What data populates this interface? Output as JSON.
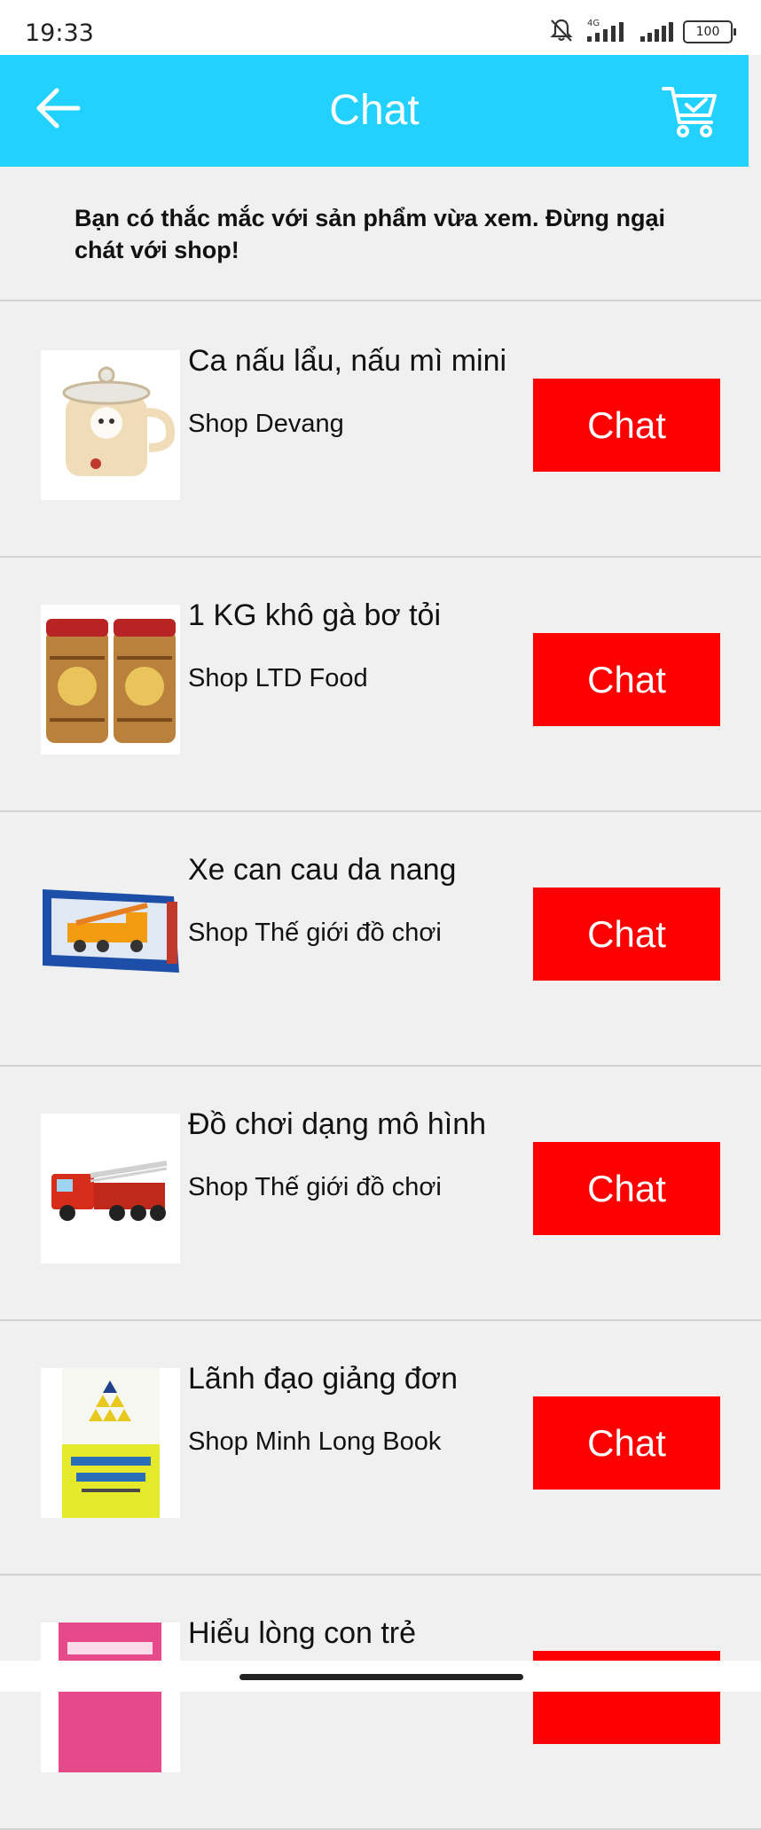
{
  "status_bar": {
    "time": "19:33",
    "battery": "100",
    "network": "4G"
  },
  "app_bar": {
    "title": "Chat",
    "back_icon": "arrow-left-icon",
    "cart_icon": "shopping-cart-check-icon",
    "background": "#22d1fd"
  },
  "intro": {
    "text": "Bạn có thắc mắc với sản phẩm vừa xem. Đừng ngại chát với shop!"
  },
  "items": [
    {
      "product": "Ca nấu lẩu, nấu mì mini",
      "shop": "Shop Devang",
      "button": "Chat",
      "image": "electric-pot-image"
    },
    {
      "product": "1 KG khô gà bơ tỏi",
      "shop": "Shop LTD Food",
      "button": "Chat",
      "image": "chicken-jars-image"
    },
    {
      "product": "Xe can cau da nang",
      "shop": "Shop Thế giới đồ chơi",
      "button": "Chat",
      "image": "crane-truck-box-image"
    },
    {
      "product": "Đồ chơi dạng mô hình",
      "shop": "Shop Thế giới đồ chơi",
      "button": "Chat",
      "image": "fire-truck-image"
    },
    {
      "product": "Lãnh đạo giảng đơn",
      "shop": "Shop Minh Long Book",
      "button": "Chat",
      "image": "leadership-book-image"
    },
    {
      "product": "Hiểu lòng con trẻ",
      "shop": "",
      "button": "",
      "image": "pink-book-image"
    }
  ],
  "colors": {
    "accent": "#22d1fd",
    "chat_button": "#fe0000",
    "background": "#f0f0f0"
  }
}
